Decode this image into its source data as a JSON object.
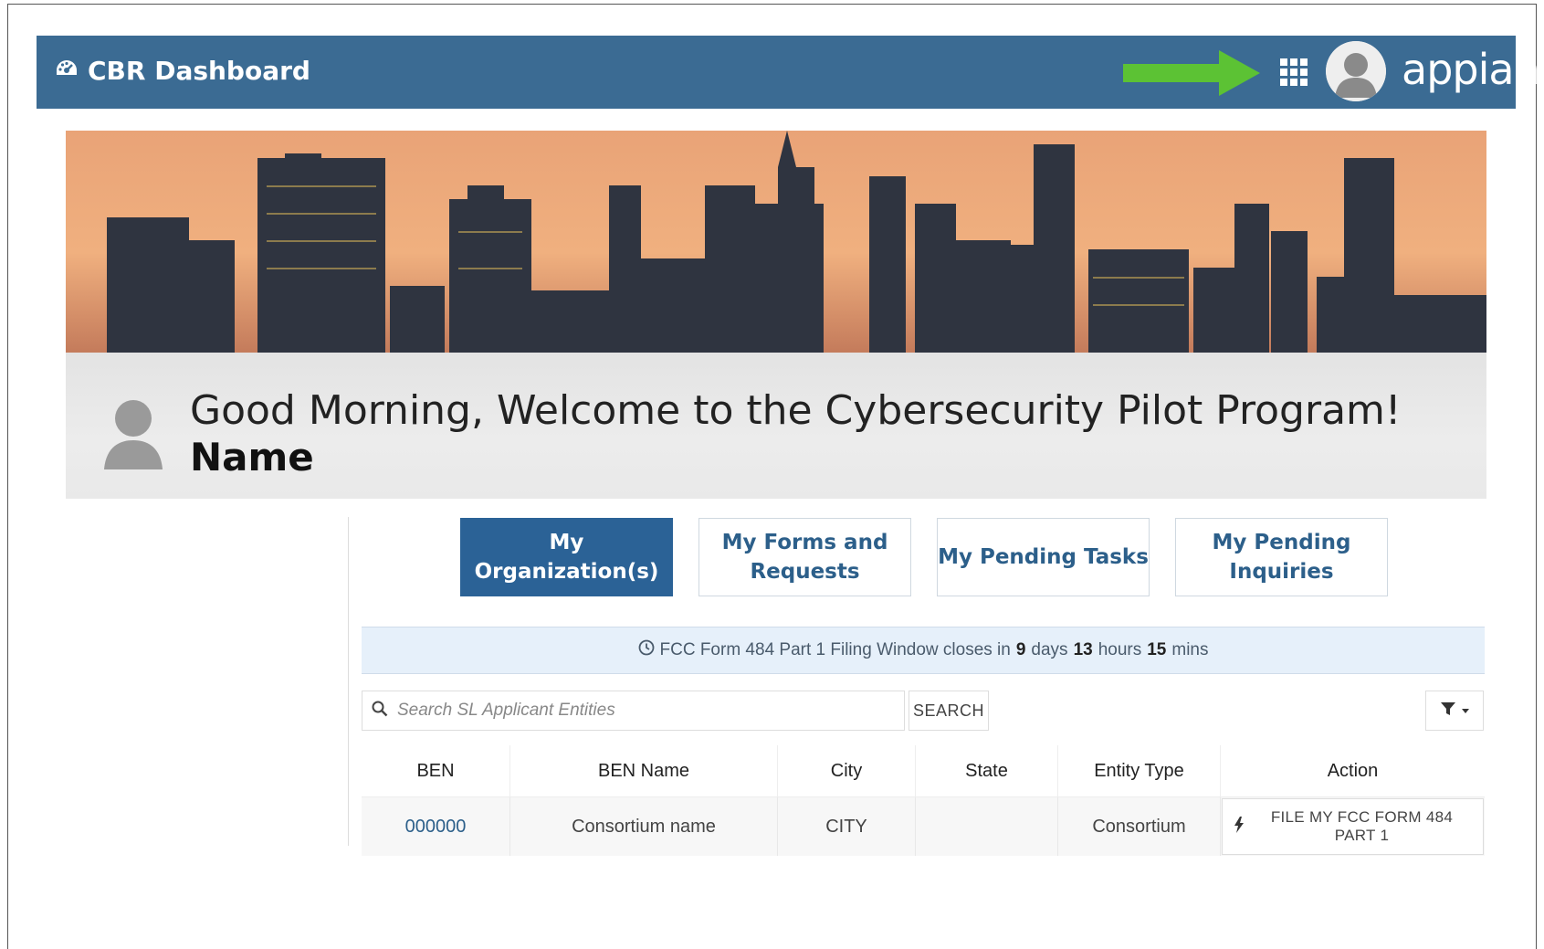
{
  "header": {
    "title": "CBR Dashboard",
    "brand": "appian",
    "accent_color": "#3b6b93",
    "icons": {
      "dashboard": "dashboard-gauge-icon",
      "apps": "apps-grid-icon",
      "arrow": "green-arrow-icon",
      "user": "user-avatar-icon"
    }
  },
  "welcome": {
    "greeting": "Good Morning, Welcome to the Cybersecurity Pilot Program!",
    "name": "Name"
  },
  "tabs": [
    {
      "label": "My Organization(s)",
      "active": true
    },
    {
      "label": "My Forms and Requests",
      "active": false
    },
    {
      "label": "My Pending Tasks",
      "active": false
    },
    {
      "label": "My Pending Inquiries",
      "active": false
    }
  ],
  "notice": {
    "prefix": "FCC Form 484 Part 1 Filing Window closes in",
    "days": "9",
    "days_label": "days",
    "hours": "13",
    "hours_label": "hours",
    "mins": "15",
    "mins_label": "mins"
  },
  "search": {
    "placeholder": "Search SL Applicant Entities",
    "button_label": "SEARCH"
  },
  "table": {
    "columns": [
      "BEN",
      "BEN Name",
      "City",
      "State",
      "Entity Type",
      "Action"
    ],
    "rows": [
      {
        "ben": "000000",
        "ben_name": "Consortium name",
        "city": "CITY",
        "state": "",
        "entity_type": "Consortium",
        "action": "FILE MY FCC FORM 484 PART 1"
      }
    ]
  }
}
